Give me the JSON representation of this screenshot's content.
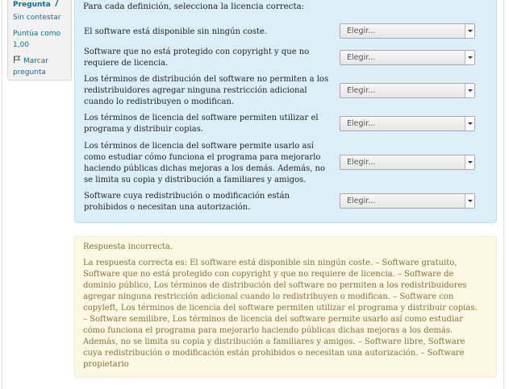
{
  "question_info": {
    "label": "Pregunta",
    "number": "7",
    "state": "Sin contestar",
    "score": "Puntúa como 1,00",
    "flag_label": "Marcar pregunta"
  },
  "formulation": {
    "prompt": "Para cada definición, selecciona la licencia correcta:",
    "rows": [
      {
        "text": "El software está disponible sin ningún coste.",
        "select": "Elegir..."
      },
      {
        "text": "Software que no está protegido con copyright y que no requiere de licencia.",
        "select": "Elegir..."
      },
      {
        "text": "Los términos de distribución del software no permiten a los redistribuidores agregar ninguna restricción adicional cuando lo redistribuyen o modifican.",
        "select": "Elegir..."
      },
      {
        "text": "Los términos de licencia del software permiten utilizar el programa y distribuir copias.",
        "select": "Elegir..."
      },
      {
        "text": "Los términos de licencia del software permite usarlo así como estudiar cómo funciona el programa para mejorarlo haciendo públicas dichas mejoras a los demás. Además, no se limita su copia y distribución a familiares y amigos.",
        "select": "Elegir..."
      },
      {
        "text": "Software cuya redistribución o modificación están prohibidos o necesitan una autorización.",
        "select": "Elegir..."
      }
    ]
  },
  "feedback": {
    "status": "Respuesta incorrecta.",
    "right_answer": "La respuesta correcta es: El software está disponible sin ningún coste. – Software gratuito, Software que no está protegido con copyright y que no requiere de licencia. – Software de dominio público, Los términos de distribución del software no permiten a los redistribuidores agregar ninguna restricción adicional cuando lo redistribuyen o modifican. – Software con copyleft, Los términos de licencia del software permiten utilizar el programa y distribuir copias. – Software semilibre, Los términos de licencia del software permite usarlo así como estudiar cómo funciona el programa para mejorarlo haciendo públicas dichas mejoras a los demás. Además, no se limita su copia y distribución a familiares y amigos. – Software libre, Software cuya redistribución o modificación están prohibidos o necesitan una autorización. – Software propietario"
  },
  "icons": {
    "flag": "flag-icon",
    "select_caret": "chevron-down-icon"
  },
  "colors": {
    "info_bg": "#dceef7",
    "feedback_bg": "#fcf8e3",
    "link": "#0070a8",
    "feedback_text": "#8a6d3b"
  }
}
